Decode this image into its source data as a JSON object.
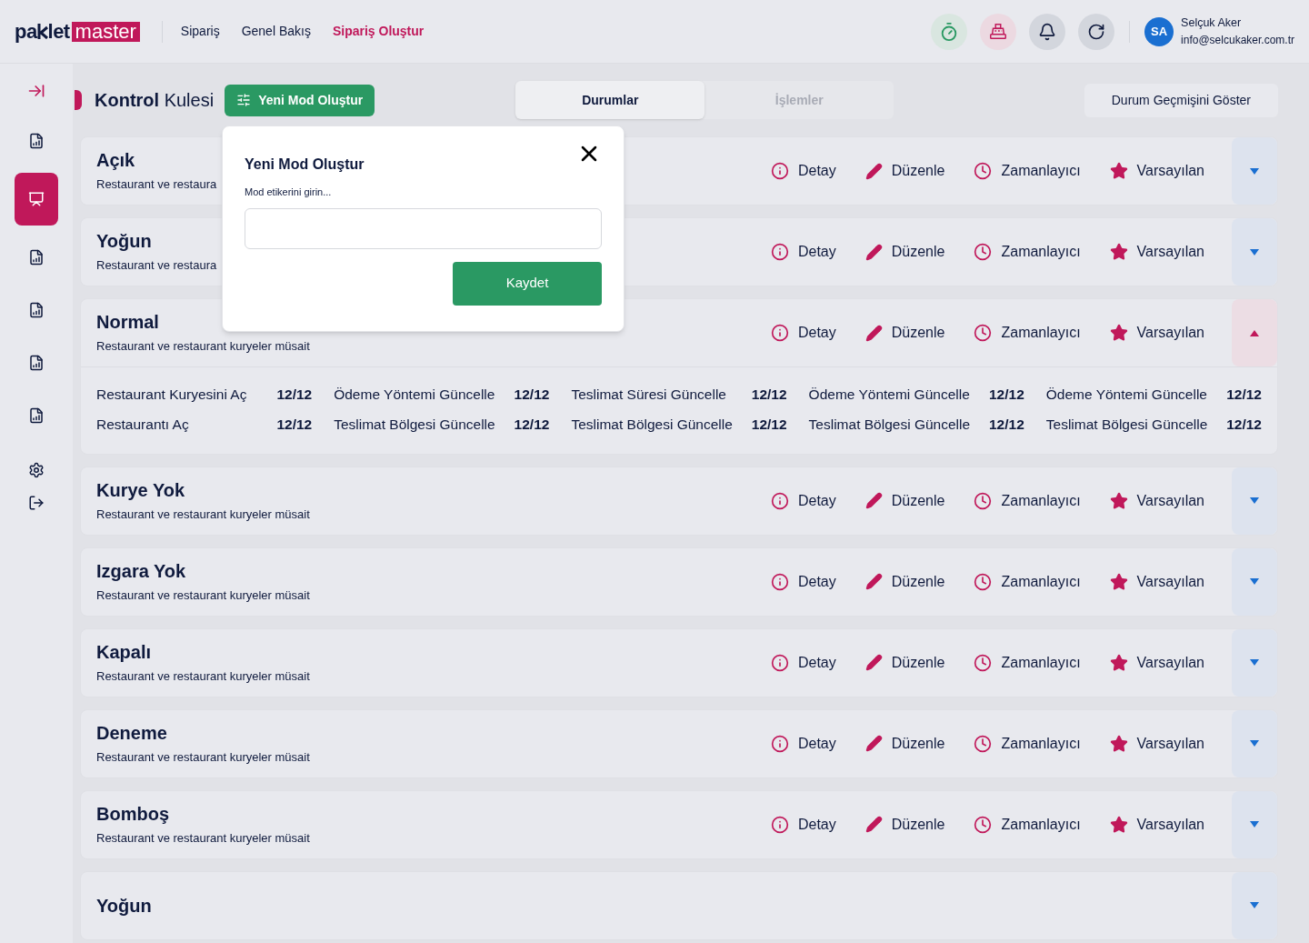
{
  "logo": {
    "part1": "pa",
    "part2": "let",
    "part3": "master"
  },
  "nav": [
    {
      "label": "Sipariş",
      "selected": false
    },
    {
      "label": "Genel Bakış",
      "selected": false
    },
    {
      "label": "Sipariş Oluştur",
      "selected": true
    }
  ],
  "header_buttons": [
    {
      "kind": "timer"
    },
    {
      "kind": "register"
    },
    {
      "kind": "bell"
    },
    {
      "kind": "refresh"
    }
  ],
  "user": {
    "initials": "SA",
    "name": "Selçuk Aker",
    "email": "info@selcukaker.com.tr"
  },
  "sidebar": {
    "items": [
      {
        "kind": "chart",
        "selected": false
      },
      {
        "kind": "presentation",
        "selected": true
      },
      {
        "kind": "chart",
        "selected": false
      },
      {
        "kind": "chart",
        "selected": false
      },
      {
        "kind": "chart",
        "selected": false
      },
      {
        "kind": "chart",
        "selected": false
      }
    ]
  },
  "page_title": {
    "bold": "Kontrol",
    "rest": "Kulesi"
  },
  "new_mode_button": "Yeni Mod Oluştur",
  "tabs": [
    {
      "label": "Durumlar",
      "selected": true
    },
    {
      "label": "İşlemler",
      "selected": false
    }
  ],
  "history_button": "Durum Geçmişini Göster",
  "modes": [
    {
      "title": "Açık",
      "description": "Restaurant ve restaura",
      "expanded": false,
      "actions": [
        "Detay",
        "Düzenle",
        "Zamanlayıcı",
        "Varsayılan"
      ]
    },
    {
      "title": "Yoğun",
      "description": "Restaurant ve restaura",
      "expanded": false,
      "actions": [
        "Detay",
        "Düzenle",
        "Zamanlayıcı",
        "Varsayılan"
      ]
    },
    {
      "title": "Normal",
      "description": "Restaurant ve restaurant kuryeler müsait",
      "expanded": true,
      "actions": [
        "Detay",
        "Düzenle",
        "Zamanlayıcı",
        "Varsayılan"
      ],
      "details": [
        [
          {
            "label": "Restaurant Kuryesini Aç",
            "count": "12/12"
          },
          {
            "label": "Restaurantı Aç",
            "count": "12/12"
          }
        ],
        [
          {
            "label": "Ödeme Yöntemi Güncelle",
            "count": "12/12"
          },
          {
            "label": "Teslimat Bölgesi Güncelle",
            "count": "12/12"
          }
        ],
        [
          {
            "label": "Teslimat Süresi Güncelle",
            "count": "12/12"
          },
          {
            "label": "Teslimat Bölgesi Güncelle",
            "count": "12/12"
          }
        ],
        [
          {
            "label": "Ödeme Yöntemi Güncelle",
            "count": "12/12"
          },
          {
            "label": "Teslimat Bölgesi Güncelle",
            "count": "12/12"
          }
        ],
        [
          {
            "label": "Ödeme Yöntemi Güncelle",
            "count": "12/12"
          },
          {
            "label": "Teslimat Bölgesi Güncelle",
            "count": "12/12"
          }
        ]
      ]
    },
    {
      "title": "Kurye Yok",
      "description": "Restaurant ve restaurant kuryeler müsait",
      "expanded": false,
      "actions": [
        "Detay",
        "Düzenle",
        "Zamanlayıcı",
        "Varsayılan"
      ]
    },
    {
      "title": "Izgara Yok",
      "description": "Restaurant ve restaurant kuryeler müsait",
      "expanded": false,
      "actions": [
        "Detay",
        "Düzenle",
        "Zamanlayıcı",
        "Varsayılan"
      ]
    },
    {
      "title": "Kapalı",
      "description": "Restaurant ve restaurant kuryeler müsait",
      "expanded": false,
      "actions": [
        "Detay",
        "Düzenle",
        "Zamanlayıcı",
        "Varsayılan"
      ]
    },
    {
      "title": "Deneme",
      "description": "Restaurant ve restaurant kuryeler müsait",
      "expanded": false,
      "actions": [
        "Detay",
        "Düzenle",
        "Zamanlayıcı",
        "Varsayılan"
      ]
    },
    {
      "title": "Bomboş",
      "description": "Restaurant ve restaurant kuryeler müsait",
      "expanded": false,
      "actions": [
        "Detay",
        "Düzenle",
        "Zamanlayıcı",
        "Varsayılan"
      ]
    },
    {
      "title": "Yoğun",
      "expanded": false
    }
  ],
  "modal": {
    "title": "Yeni Mod Oluştur",
    "label": "Mod etikerini girin...",
    "save": "Kaydet"
  }
}
